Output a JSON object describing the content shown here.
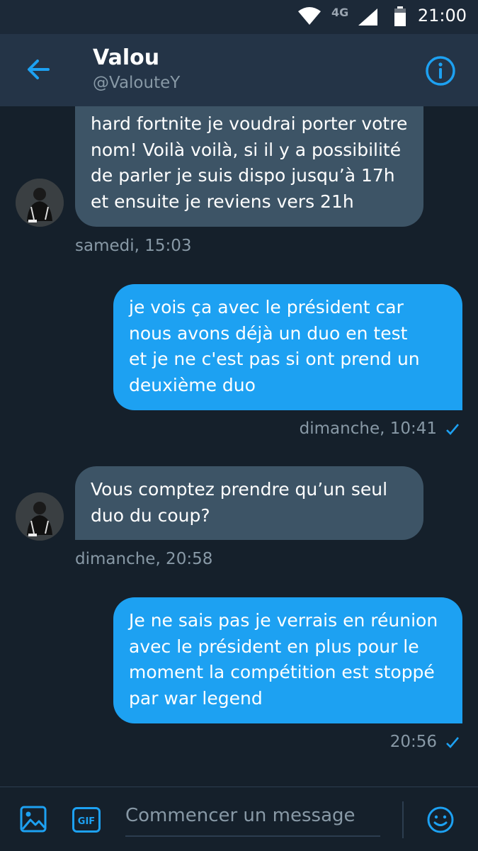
{
  "status_bar": {
    "network": "4G",
    "time": "21:00"
  },
  "header": {
    "name": "Valou",
    "handle": "@ValouteY"
  },
  "messages": [
    {
      "direction": "incoming",
      "lines": [
        "hard fortnite je voudrai porter votre",
        "nom! Voilà voilà, si il y a possibilité",
        "de parler je suis dispo jusqu’à 17h",
        "et ensuite je reviens vers 21h"
      ],
      "timestamp": "samedi, 15:03"
    },
    {
      "direction": "outgoing",
      "lines": [
        "je vois ça avec le président car",
        "nous avons déjà un duo en test",
        "et je ne c'est pas si ont prend un",
        "deuxième duo"
      ],
      "timestamp": "dimanche, 10:41"
    },
    {
      "direction": "incoming",
      "lines": [
        "Vous comptez prendre qu’un seul",
        "duo du coup?"
      ],
      "timestamp": "dimanche, 20:58"
    },
    {
      "direction": "outgoing",
      "lines": [
        "Je ne sais pas je verrais en réunion",
        "avec le président en plus pour le",
        "moment la compétition est stoppé",
        "par war legend"
      ],
      "timestamp": "20:56"
    }
  ],
  "compose": {
    "placeholder": "Commencer un message",
    "gif_label": "GIF"
  },
  "colors": {
    "background": "#15202b",
    "header": "#243447",
    "incoming_bubble": "#3d5466",
    "outgoing_bubble": "#1da1f2",
    "accent": "#1da1f2",
    "muted_text": "#8899a6"
  },
  "icons": [
    "wifi-icon",
    "signal-icon",
    "battery-icon",
    "back-arrow-icon",
    "info-icon",
    "avatar",
    "check-icon",
    "image-icon",
    "gif-icon",
    "emoji-icon"
  ]
}
